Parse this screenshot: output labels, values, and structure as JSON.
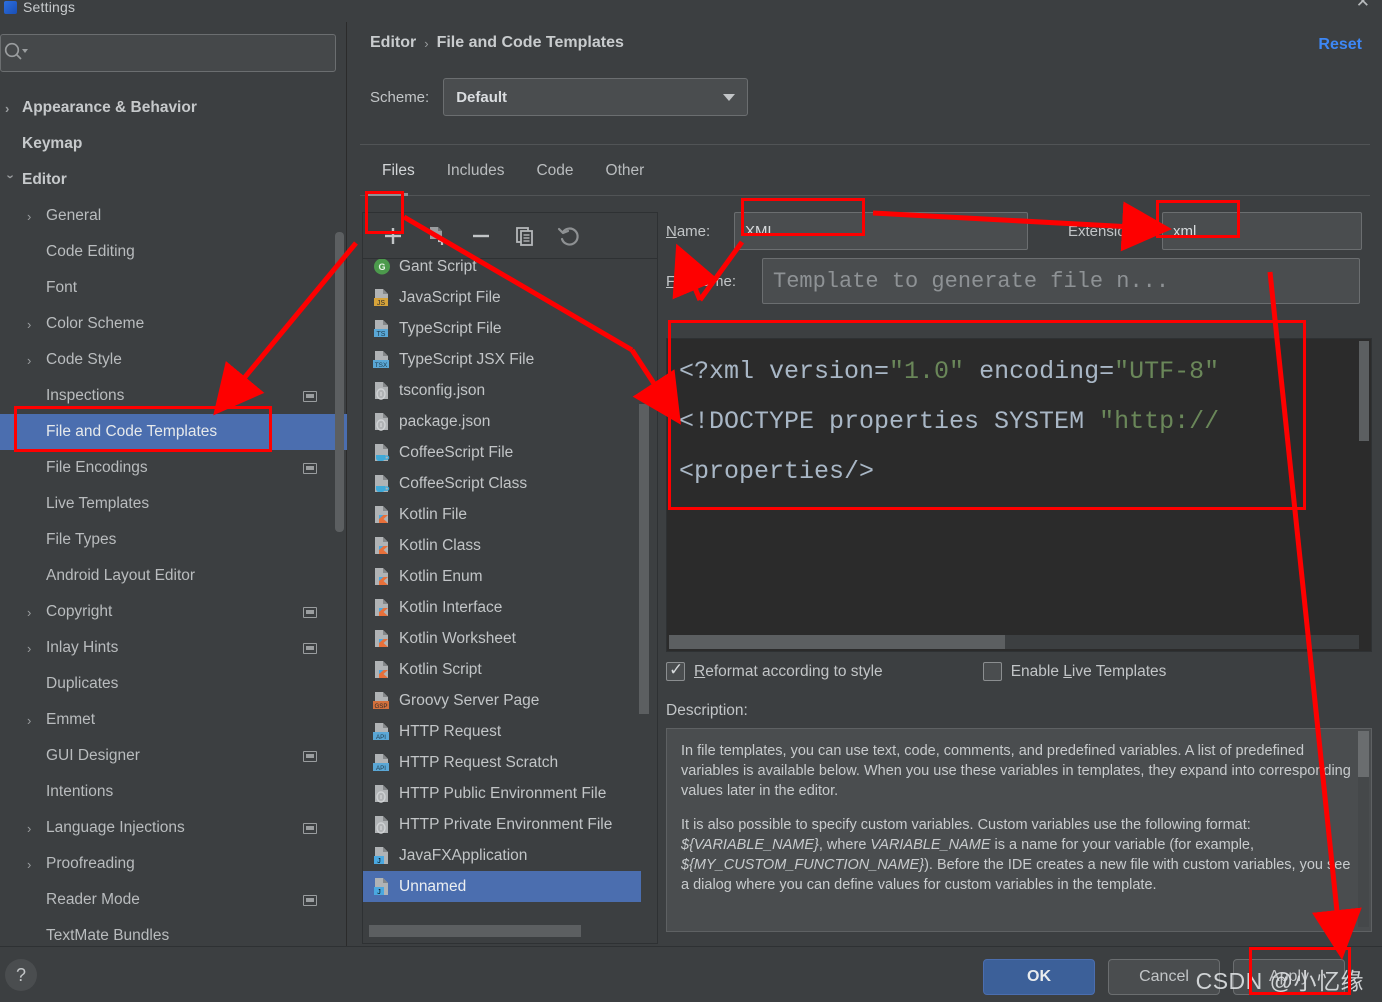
{
  "window": {
    "title": "Settings",
    "logo_letter": "IJ",
    "close_icon": "close-icon"
  },
  "sidebar": {
    "search": {
      "placeholder": "",
      "value": "",
      "icon": "search-icon"
    },
    "items": [
      {
        "label": "Appearance & Behavior",
        "level": 0,
        "chevron": "right",
        "badge": false,
        "selected": false
      },
      {
        "label": "Keymap",
        "level": 0,
        "chevron": "none",
        "badge": false,
        "selected": false
      },
      {
        "label": "Editor",
        "level": 0,
        "chevron": "down",
        "badge": false,
        "selected": false
      },
      {
        "label": "General",
        "level": 1,
        "chevron": "right",
        "badge": false,
        "selected": false
      },
      {
        "label": "Code Editing",
        "level": 1,
        "chevron": "none",
        "badge": false,
        "selected": false
      },
      {
        "label": "Font",
        "level": 1,
        "chevron": "none",
        "badge": false,
        "selected": false
      },
      {
        "label": "Color Scheme",
        "level": 1,
        "chevron": "right",
        "badge": false,
        "selected": false
      },
      {
        "label": "Code Style",
        "level": 1,
        "chevron": "right",
        "badge": false,
        "selected": false
      },
      {
        "label": "Inspections",
        "level": 1,
        "chevron": "none",
        "badge": true,
        "selected": false
      },
      {
        "label": "File and Code Templates",
        "level": 1,
        "chevron": "none",
        "badge": false,
        "selected": true
      },
      {
        "label": "File Encodings",
        "level": 1,
        "chevron": "none",
        "badge": true,
        "selected": false
      },
      {
        "label": "Live Templates",
        "level": 1,
        "chevron": "none",
        "badge": false,
        "selected": false
      },
      {
        "label": "File Types",
        "level": 1,
        "chevron": "none",
        "badge": false,
        "selected": false
      },
      {
        "label": "Android Layout Editor",
        "level": 1,
        "chevron": "none",
        "badge": false,
        "selected": false
      },
      {
        "label": "Copyright",
        "level": 1,
        "chevron": "right",
        "badge": true,
        "selected": false
      },
      {
        "label": "Inlay Hints",
        "level": 1,
        "chevron": "right",
        "badge": true,
        "selected": false
      },
      {
        "label": "Duplicates",
        "level": 1,
        "chevron": "none",
        "badge": false,
        "selected": false
      },
      {
        "label": "Emmet",
        "level": 1,
        "chevron": "right",
        "badge": false,
        "selected": false
      },
      {
        "label": "GUI Designer",
        "level": 1,
        "chevron": "none",
        "badge": true,
        "selected": false
      },
      {
        "label": "Intentions",
        "level": 1,
        "chevron": "none",
        "badge": false,
        "selected": false
      },
      {
        "label": "Language Injections",
        "level": 1,
        "chevron": "right",
        "badge": true,
        "selected": false
      },
      {
        "label": "Proofreading",
        "level": 1,
        "chevron": "right",
        "badge": false,
        "selected": false
      },
      {
        "label": "Reader Mode",
        "level": 1,
        "chevron": "none",
        "badge": true,
        "selected": false
      },
      {
        "label": "TextMate Bundles",
        "level": 1,
        "chevron": "none",
        "badge": false,
        "selected": false
      }
    ]
  },
  "header": {
    "breadcrumb_parent": "Editor",
    "breadcrumb_sep": "›",
    "breadcrumb_current": "File and Code Templates",
    "reset_label": "Reset",
    "scheme_label": "Scheme:",
    "scheme_value": "Default"
  },
  "tabs": [
    {
      "label": "Files",
      "active": true
    },
    {
      "label": "Includes",
      "active": false
    },
    {
      "label": "Code",
      "active": false
    },
    {
      "label": "Other",
      "active": false
    }
  ],
  "toolbar": [
    {
      "name": "add-template-button",
      "icon": "plus-icon",
      "tooltip": "Add"
    },
    {
      "name": "add-child-template-button",
      "icon": "add-file-icon",
      "tooltip": "Create Child Template File"
    },
    {
      "name": "remove-template-button",
      "icon": "minus-icon",
      "tooltip": "Remove"
    },
    {
      "name": "copy-template-button",
      "icon": "copy-icon",
      "tooltip": "Copy"
    },
    {
      "name": "reset-template-button",
      "icon": "revert-icon",
      "tooltip": "Reset To Default"
    }
  ],
  "file_list": {
    "items": [
      {
        "label": "Gant Script",
        "icon": "groovy-gant-icon",
        "selected": false
      },
      {
        "label": "JavaScript File",
        "icon": "js-file-icon",
        "selected": false
      },
      {
        "label": "TypeScript File",
        "icon": "ts-file-icon",
        "selected": false
      },
      {
        "label": "TypeScript JSX File",
        "icon": "tsx-file-icon",
        "selected": false
      },
      {
        "label": "tsconfig.json",
        "icon": "json-file-icon",
        "selected": false
      },
      {
        "label": "package.json",
        "icon": "json-file-icon",
        "selected": false
      },
      {
        "label": "CoffeeScript File",
        "icon": "coffee-file-icon",
        "selected": false
      },
      {
        "label": "CoffeeScript Class",
        "icon": "coffee-file-icon",
        "selected": false
      },
      {
        "label": "Kotlin File",
        "icon": "kotlin-file-icon",
        "selected": false
      },
      {
        "label": "Kotlin Class",
        "icon": "kotlin-file-icon",
        "selected": false
      },
      {
        "label": "Kotlin Enum",
        "icon": "kotlin-file-icon",
        "selected": false
      },
      {
        "label": "Kotlin Interface",
        "icon": "kotlin-file-icon",
        "selected": false
      },
      {
        "label": "Kotlin Worksheet",
        "icon": "kotlin-file-icon",
        "selected": false
      },
      {
        "label": "Kotlin Script",
        "icon": "kotlin-file-icon",
        "selected": false
      },
      {
        "label": "Groovy Server Page",
        "icon": "gsp-file-icon",
        "selected": false
      },
      {
        "label": "HTTP Request",
        "icon": "api-file-icon",
        "selected": false
      },
      {
        "label": "HTTP Request Scratch",
        "icon": "api-file-icon",
        "selected": false
      },
      {
        "label": "HTTP Public Environment File",
        "icon": "json-file-icon",
        "selected": false
      },
      {
        "label": "HTTP Private Environment File",
        "icon": "json-file-icon",
        "selected": false
      },
      {
        "label": "JavaFXApplication",
        "icon": "java-file-icon",
        "selected": false
      },
      {
        "label": "Unnamed",
        "icon": "java-file-icon",
        "selected": true
      }
    ]
  },
  "template_form": {
    "name_label": "Name:",
    "name_label_mnemonic": "N",
    "name_value": "XML",
    "extension_label": "Extension:",
    "extension_value": "xml",
    "file_name_label": "File name:",
    "file_name_label_mnemonic": "Fi",
    "file_name_placeholder": "Template to generate file n...",
    "file_name_value": ""
  },
  "editor": {
    "lines": [
      [
        {
          "t": "<?xml version=",
          "c": "plain"
        },
        {
          "t": "\"1.0\"",
          "c": "str"
        },
        {
          "t": " encoding=",
          "c": "plain"
        },
        {
          "t": "\"UTF-8\"",
          "c": "str"
        }
      ],
      [
        {
          "t": "<!DOCTYPE properties SYSTEM ",
          "c": "plain"
        },
        {
          "t": "\"http://",
          "c": "str"
        }
      ],
      [
        {
          "t": "<properties/>",
          "c": "plain"
        }
      ]
    ]
  },
  "options": {
    "reformat": {
      "label": "Reformat according to style",
      "mnemonic": "R",
      "checked": true
    },
    "live_templates": {
      "label": "Enable Live Templates",
      "mnemonic": "L",
      "checked": false
    }
  },
  "description": {
    "label": "Description:",
    "paragraphs": [
      "In file templates, you can use text, code, comments, and predefined variables. A list of predefined variables is available below. When you use these variables in templates, they expand into corresponding values later in the editor.",
      "It is also possible to specify custom variables. Custom variables use the following format: ${VARIABLE_NAME}, where VARIABLE_NAME is a name for your variable (for example, ${MY_CUSTOM_FUNCTION_NAME}). Before the IDE creates a new file with custom variables, you see a dialog where you can define values for custom variables in the template."
    ]
  },
  "footer": {
    "help_icon": "question-mark-icon",
    "ok_label": "OK",
    "cancel_label": "Cancel",
    "apply_label": "Apply"
  },
  "watermark": {
    "text": "CSDN @小忆缘"
  },
  "colors": {
    "background": "#3c3f41",
    "selection": "#4b6eaf",
    "accent_link": "#3d87f5",
    "editor_background": "#2b2b2b",
    "code_string": "#6a8759",
    "annotation_red": "#fe0000",
    "ok_button": "#3c6099"
  }
}
